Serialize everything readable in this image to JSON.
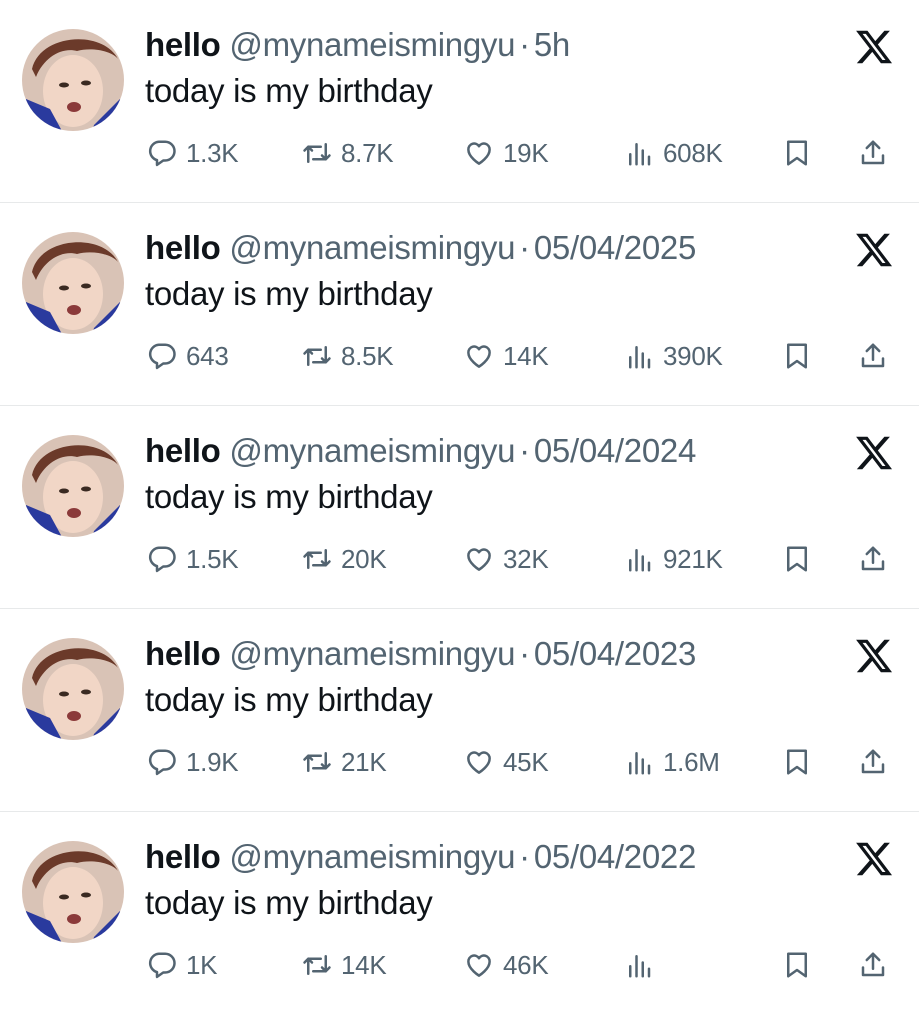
{
  "colors": {
    "text": "#0f1419",
    "secondary": "#536471",
    "divider": "#e7e9ea",
    "background": "#ffffff"
  },
  "icons": [
    "reply-icon",
    "retweet-icon",
    "like-icon",
    "views-icon",
    "bookmark-icon",
    "share-icon",
    "x-logo-icon"
  ],
  "tweets": [
    {
      "name": "hello",
      "handle": "@mynameismingyu",
      "sep": "·",
      "time": "5h",
      "text": "today is my birthday",
      "replies": "1.3K",
      "retweets": "8.7K",
      "likes": "19K",
      "views": "608K"
    },
    {
      "name": "hello",
      "handle": "@mynameismingyu",
      "sep": "·",
      "time": "05/04/2025",
      "text": "today is my birthday",
      "replies": "643",
      "retweets": "8.5K",
      "likes": "14K",
      "views": "390K"
    },
    {
      "name": "hello",
      "handle": "@mynameismingyu",
      "sep": "·",
      "time": "05/04/2024",
      "text": "today is my birthday",
      "replies": "1.5K",
      "retweets": "20K",
      "likes": "32K",
      "views": "921K"
    },
    {
      "name": "hello",
      "handle": "@mynameismingyu",
      "sep": "·",
      "time": "05/04/2023",
      "text": "today is my birthday",
      "replies": "1.9K",
      "retweets": "21K",
      "likes": "45K",
      "views": "1.6M"
    },
    {
      "name": "hello",
      "handle": "@mynameismingyu",
      "sep": "·",
      "time": "05/04/2022",
      "text": "today is my birthday",
      "replies": "1K",
      "retweets": "14K",
      "likes": "46K",
      "views": ""
    }
  ]
}
